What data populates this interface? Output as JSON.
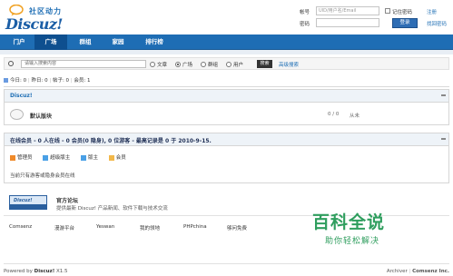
{
  "header": {
    "logo_slogan": "社区动力",
    "logo_word": "Discuz!",
    "login": {
      "account_label": "帐号",
      "account_placeholder": "UID/用户名/Email",
      "password_label": "密码",
      "remember_label": "记住密码",
      "register_link": "注册",
      "forgot_link": "找回密码",
      "login_button": "登录"
    }
  },
  "nav": {
    "items": [
      "门户",
      "广场",
      "群组",
      "家园",
      "排行榜"
    ],
    "active": "广场"
  },
  "search": {
    "placeholder": "请输入搜索内容",
    "options": [
      "文章",
      "广场",
      "群组",
      "用户"
    ],
    "selected": "广场",
    "button": "搜索",
    "advanced": "高级搜索"
  },
  "stats": {
    "today": "今日: 0",
    "yesterday": "昨日: 0",
    "posts": "帖子: 0",
    "members": "会员: 1"
  },
  "forum_group": {
    "title": "Discuz!",
    "forum_name": "默认版块",
    "counts": "0 / 0",
    "last_post": "从未"
  },
  "online": {
    "title": "在线会员 - 0 人在线 - 0 会员(0 隐身), 0 位游客 - 最高记录是 0 于 2010-9-15.",
    "legend": [
      {
        "label": "管理员",
        "color": "#f08a2a"
      },
      {
        "label": "超级版主",
        "color": "#4aa0e6"
      },
      {
        "label": "版主",
        "color": "#4aa0e6"
      },
      {
        "label": "会员",
        "color": "#f2b84a"
      }
    ],
    "note": "当前只有游客或隐身会员在线"
  },
  "links": {
    "banner_text": "Discuz!",
    "official_title": "官方论坛",
    "official_desc": "提供最新 Discuz! 产品新闻、软件下载与技术交流",
    "items": [
      "Comsenz",
      "漫游平台",
      "Yeswan",
      "我的领地",
      "PHPchina",
      "够问免费"
    ]
  },
  "footer": {
    "powered_prefix": "Powered by",
    "powered_brand": "Discuz!",
    "version": "X1.5",
    "archiver": "Archiver",
    "company": "Comsenz Inc."
  },
  "watermark": {
    "title": "百科全说",
    "subtitle": "助你轻松解决"
  }
}
